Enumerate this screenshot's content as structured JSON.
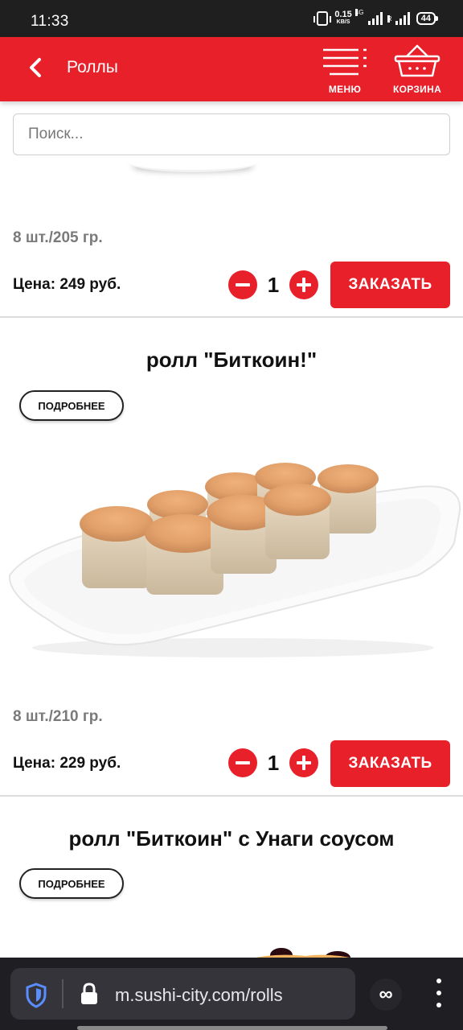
{
  "status_bar": {
    "time": "11:33",
    "net_speed_value": "0.15",
    "net_speed_unit": "KB/S",
    "network_label": "4G",
    "roaming_label": "R",
    "battery": "44"
  },
  "header": {
    "title": "Роллы",
    "menu_label": "МЕНЮ",
    "cart_label": "КОРЗИНА",
    "color": "#e8202a"
  },
  "search": {
    "placeholder": "Поиск..."
  },
  "products": [
    {
      "weight": "8 шт./205 гр.",
      "price": "Цена: 249 руб.",
      "quantity": "1",
      "order_label": "ЗАКАЗАТЬ"
    },
    {
      "title": "ролл \"Биткоин!\"",
      "details_label": "ПОДРОБНЕЕ",
      "weight": "8 шт./210 гр.",
      "price": "Цена: 229 руб.",
      "quantity": "1",
      "order_label": "ЗАКАЗАТЬ"
    },
    {
      "title": "ролл \"Биткоин\" с Унаги соусом",
      "details_label": "ПОДРОБНЕЕ"
    }
  ],
  "browser": {
    "url": "m.sushi-city.com/rolls",
    "infinity_label": "∞"
  }
}
